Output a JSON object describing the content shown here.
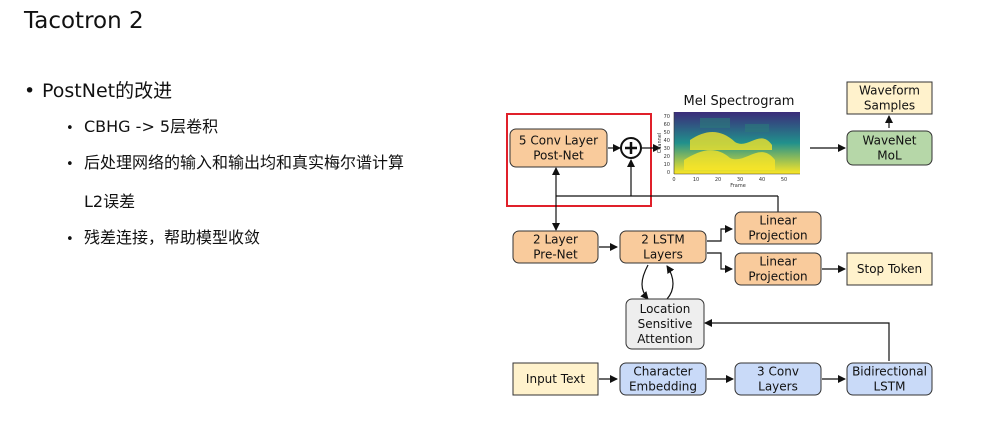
{
  "slide": {
    "title": "Tacotron 2",
    "bullet": "PostNet的改进",
    "sub_bullets": [
      "CBHG -> 5层卷积",
      "后处理网络的输入和输出均和真实梅尔谱计算",
      "残差连接，帮助模型收敛"
    ],
    "sub_bullet_continuation": "L2误差"
  },
  "diagram": {
    "colors": {
      "orange": "#f9cb9c",
      "green": "#b6d7a8",
      "blue": "#c9daf8",
      "yellow": "#fff2cc",
      "gray": "#eeeeee",
      "highlight": "#e0202a"
    },
    "nodes": {
      "postnet": [
        "5 Conv Layer",
        "Post-Net"
      ],
      "prenet": [
        "2 Layer",
        "Pre-Net"
      ],
      "lstm": [
        "2 LSTM",
        "Layers"
      ],
      "linear_top": [
        "Linear",
        "Projection"
      ],
      "linear_bottom": [
        "Linear",
        "Projection"
      ],
      "stop": [
        "Stop Token"
      ],
      "attention": [
        "Location",
        "Sensitive",
        "Attention"
      ],
      "input": [
        "Input Text"
      ],
      "embedding": [
        "Character",
        "Embedding"
      ],
      "conv3": [
        "3 Conv",
        "Layers"
      ],
      "bilstm": [
        "Bidirectional",
        "LSTM"
      ],
      "wavenet": [
        "WaveNet",
        "MoL"
      ],
      "waveform": [
        "Waveform",
        "Samples"
      ]
    },
    "spectrogram": {
      "title": "Mel Spectrogram",
      "xlabel": "Frame",
      "ylabel": "Channel",
      "x_ticks": [
        "0",
        "10",
        "20",
        "30",
        "40",
        "50"
      ],
      "y_ticks": [
        "0",
        "10",
        "20",
        "30",
        "40",
        "50",
        "60",
        "70"
      ]
    }
  }
}
